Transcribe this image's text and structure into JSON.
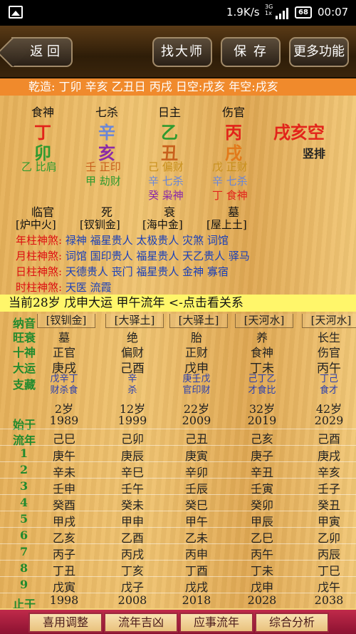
{
  "status_bar": {
    "speed": "1.9K/s",
    "network": "3G",
    "network2": "1x",
    "battery": "68",
    "time": "00:07"
  },
  "toolbar": {
    "back": "返 回",
    "find_master": "找大师",
    "save": "保 存",
    "more": "更多功能"
  },
  "qianzao": "乾造: 丁卯 辛亥 乙丑日 丙戌  日空:戌亥 年空:戌亥",
  "pillars": [
    {
      "shishen": "食神",
      "gan": "丁",
      "gan_color": "#e2231a",
      "zhi": "卯",
      "zhi_color": "#2f9a2f",
      "hidden": [
        {
          "text": "乙 比肩",
          "color": "#2f9a2f"
        }
      ],
      "changsheng": "临官",
      "nayin": "[炉中火]"
    },
    {
      "shishen": "七杀",
      "gan": "辛",
      "gan_color": "#6a86d8",
      "zhi": "亥",
      "zhi_color": "#8a2aa8",
      "hidden": [
        {
          "text": "壬 正印",
          "color": "#c8601c"
        },
        {
          "text": "甲 劫财",
          "color": "#2f9a2f"
        }
      ],
      "changsheng": "死",
      "nayin": "[钗钏金]"
    },
    {
      "shishen": "日主",
      "gan": "乙",
      "gan_color": "#2f9a2f",
      "zhi": "丑",
      "zhi_color": "#c8601c",
      "hidden": [
        {
          "text": "己 偏财",
          "color": "#c8901c"
        },
        {
          "text": "辛 七杀",
          "color": "#6a86d8"
        },
        {
          "text": "癸 枭神",
          "color": "#8a2aa8"
        }
      ],
      "changsheng": "衰",
      "nayin": "[海中金]"
    },
    {
      "shishen": "伤官",
      "gan": "丙",
      "gan_color": "#e2231a",
      "zhi": "戌",
      "zhi_color": "#e27a1a",
      "hidden": [
        {
          "text": "戊 正财",
          "color": "#c8901c"
        },
        {
          "text": "辛 七杀",
          "color": "#6a86d8"
        },
        {
          "text": "丁 食神",
          "color": "#e2231a"
        }
      ],
      "changsheng": "墓",
      "nayin": "[屋上土]"
    }
  ],
  "kong": "戌亥空",
  "vertical_btn": "竖排",
  "shensha": [
    {
      "k": "年柱神煞:",
      "v": "禄神 福星贵人 太极贵人 灾煞 词馆"
    },
    {
      "k": "月柱神煞:",
      "v": "词馆 国印贵人 福星贵人 天乙贵人 驿马"
    },
    {
      "k": "日柱神煞:",
      "v": "天德贵人 丧门 福星贵人 金神 寡宿"
    },
    {
      "k": "时柱神煞:",
      "v": "天医 流霞"
    }
  ],
  "now_bar": "当前28岁 戊申大运 甲午流年   <-点击看关系",
  "dayun_labels": {
    "nayin": "纳音",
    "wangshuai": "旺衰",
    "shishen": "十神",
    "dayun": "大运",
    "zhicang": "支藏",
    "shiyu": "始于",
    "liunian": "流年",
    "zhiyu": "止于"
  },
  "dayun": [
    {
      "nayin": "[钗钏金]",
      "ws": "墓",
      "ss": "正官",
      "gz": "庚戌",
      "zc1": "戊辛丁",
      "zc2": "财杀食",
      "age": "2岁",
      "start": "1989",
      "end": "1998",
      "first": "己巳",
      "years": [
        "庚午",
        "辛未",
        "壬申",
        "癸酉",
        "甲戌",
        "乙亥",
        "丙子",
        "丁丑",
        "戊寅"
      ]
    },
    {
      "nayin": "[大驿土]",
      "ws": "绝",
      "ss": "偏财",
      "gz": "己酉",
      "zc1": "辛",
      "zc2": "杀",
      "age": "12岁",
      "start": "1999",
      "end": "2008",
      "first": "己卯",
      "years": [
        "庚辰",
        "辛巳",
        "壬午",
        "癸未",
        "甲申",
        "乙酉",
        "丙戌",
        "丁亥",
        "戊子"
      ]
    },
    {
      "nayin": "[大驿土]",
      "ws": "胎",
      "ss": "正财",
      "gz": "戊申",
      "zc1": "庚壬戊",
      "zc2": "官印财",
      "age": "22岁",
      "start": "2009",
      "end": "2018",
      "first": "己丑",
      "years": [
        "庚寅",
        "辛卯",
        "壬辰",
        "癸巳",
        "甲午",
        "乙未",
        "丙申",
        "丁酉",
        "戊戌"
      ]
    },
    {
      "nayin": "[天河水]",
      "ws": "养",
      "ss": "食神",
      "gz": "丁未",
      "zc1": "己丁乙",
      "zc2": "才食比",
      "age": "32岁",
      "start": "2019",
      "end": "2028",
      "first": "己亥",
      "years": [
        "庚子",
        "辛丑",
        "壬寅",
        "癸卯",
        "甲辰",
        "乙巳",
        "丙午",
        "丁未",
        "戊申"
      ]
    },
    {
      "nayin": "[天河水]",
      "ws": "长生",
      "ss": "伤官",
      "gz": "丙午",
      "zc1": "丁己",
      "zc2": "食才",
      "age": "42岁",
      "start": "2029",
      "end": "2038",
      "first": "己酉",
      "years": [
        "庚戌",
        "辛亥",
        "壬子",
        "癸丑",
        "甲寅",
        "乙卯",
        "丙辰",
        "丁巳",
        "戊午"
      ]
    }
  ],
  "liunian_index": [
    "1",
    "2",
    "3",
    "4",
    "5",
    "6",
    "7",
    "8",
    "9"
  ],
  "bottom_tabs": [
    "喜用调整",
    "流年吉凶",
    "应事流年",
    "综合分析"
  ]
}
